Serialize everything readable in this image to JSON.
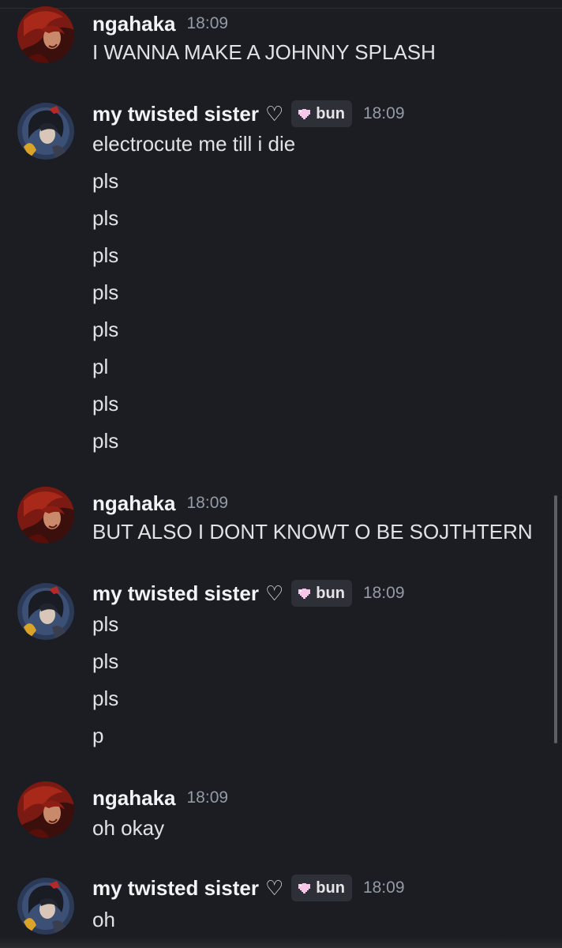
{
  "colors": {
    "background": "#1c1d22",
    "username": "#f2f3f5",
    "timestamp": "#949ba4",
    "message_text": "#e0e2e5",
    "tag_background": "#2e3037",
    "tag_heart": "#f7c6e8"
  },
  "messages": [
    {
      "author": "ngahaka",
      "time": "18:09",
      "lines": [
        "I WANNA MAKE A JOHNNY SPLASH"
      ]
    },
    {
      "author": "my twisted sister",
      "heart": "♡",
      "tag": "bun",
      "time": "18:09",
      "lines": [
        "electrocute me till i die",
        "pls",
        "pls",
        "pls",
        "pls",
        "pls",
        "pl",
        "pls",
        "pls"
      ]
    },
    {
      "author": "ngahaka",
      "time": "18:09",
      "lines": [
        "BUT ALSO I DONT KNOWT O BE SOJTHTERN"
      ]
    },
    {
      "author": "my twisted sister",
      "heart": "♡",
      "tag": "bun",
      "time": "18:09",
      "lines": [
        "pls",
        "pls",
        "pls",
        "p"
      ]
    },
    {
      "author": "ngahaka",
      "time": "18:09",
      "lines": [
        "oh okay"
      ]
    },
    {
      "author": "my twisted sister",
      "heart": "♡",
      "tag": "bun",
      "time": "18:09",
      "lines": [
        "oh"
      ]
    }
  ],
  "icons": {
    "avatar_ngahaka": "red-haired-character-avatar-icon",
    "avatar_sister": "dark-haired-character-avatar-icon",
    "tag_heart": "pixel-heart-icon"
  }
}
